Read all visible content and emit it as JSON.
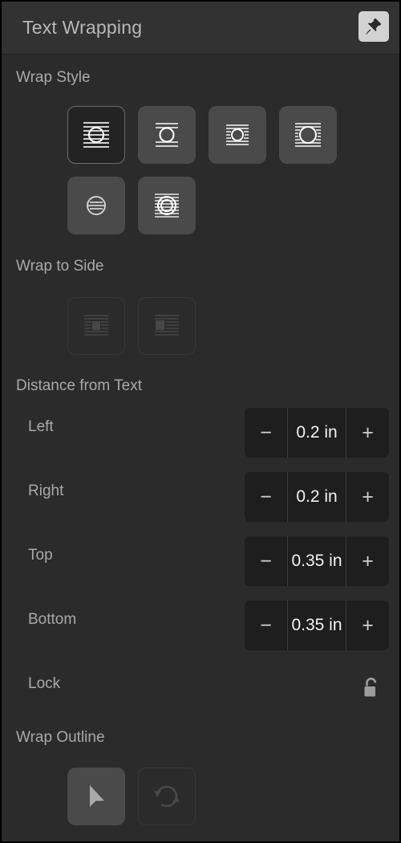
{
  "window": {
    "title": "Text Wrapping",
    "pin_icon": "pushpin-icon"
  },
  "sections": {
    "wrap_style": {
      "label": "Wrap Style",
      "options": [
        {
          "id": "inline-with-text",
          "icon": "wrap-inline-icon",
          "selected": true,
          "enabled": true
        },
        {
          "id": "top-and-bottom",
          "icon": "wrap-top-bottom-icon",
          "selected": false,
          "enabled": true
        },
        {
          "id": "square-tight",
          "icon": "wrap-square-icon",
          "selected": false,
          "enabled": true
        },
        {
          "id": "around",
          "icon": "wrap-around-icon",
          "selected": false,
          "enabled": true
        },
        {
          "id": "none",
          "icon": "wrap-none-icon",
          "selected": false,
          "enabled": true
        },
        {
          "id": "through",
          "icon": "wrap-through-icon",
          "selected": false,
          "enabled": true
        }
      ]
    },
    "wrap_to_side": {
      "label": "Wrap to Side",
      "options": [
        {
          "id": "wrap-both-sides",
          "icon": "wrap-side-both-icon",
          "selected": false,
          "enabled": false
        },
        {
          "id": "wrap-right-side",
          "icon": "wrap-side-right-icon",
          "selected": false,
          "enabled": false
        }
      ]
    },
    "distance_from_text": {
      "label": "Distance from Text",
      "rows": [
        {
          "id": "left",
          "label": "Left",
          "value": "0.2 in",
          "two_line": false,
          "decrement": "−",
          "increment": "+"
        },
        {
          "id": "right",
          "label": "Right",
          "value": "0.2 in",
          "two_line": false,
          "decrement": "−",
          "increment": "+"
        },
        {
          "id": "top",
          "label": "Top",
          "value": "0.35 in",
          "two_line": true,
          "decrement": "−",
          "increment": "+"
        },
        {
          "id": "bottom",
          "label": "Bottom",
          "value": "0.35 in",
          "two_line": true,
          "decrement": "−",
          "increment": "+"
        }
      ],
      "lock": {
        "label": "Lock",
        "icon": "unlocked-padlock-icon",
        "locked": false
      }
    },
    "wrap_outline": {
      "label": "Wrap Outline",
      "options": [
        {
          "id": "edit-outline",
          "icon": "pointer-arrow-icon",
          "enabled": true
        },
        {
          "id": "reset-outline",
          "icon": "reset-refresh-icon",
          "enabled": false
        }
      ]
    }
  },
  "colors": {
    "panel_background": "#2b2b2b",
    "titlebar_background": "#323232",
    "button_fill": "#4a4a4a",
    "selected_button_fill": "#232323",
    "selected_button_border": "#6e6e6e",
    "stepper_background": "#1e1e1e",
    "label_text": "#a9a9a9",
    "value_text": "#f2f2f2",
    "pin_button_fill": "#d2d2d2",
    "disabled_outline": "#373737"
  }
}
